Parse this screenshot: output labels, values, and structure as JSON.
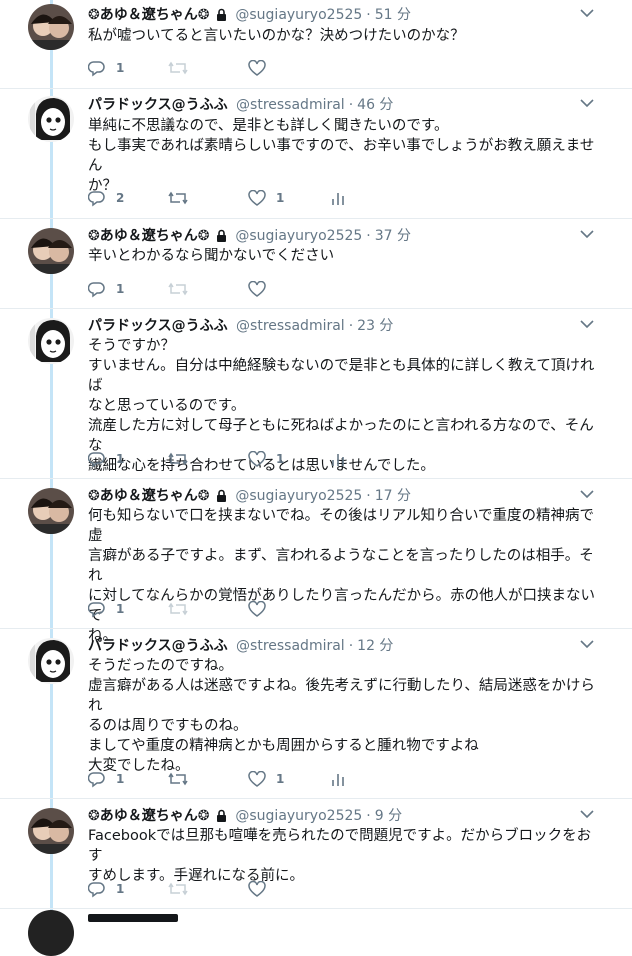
{
  "colors": {
    "thread_line": "#c4e4f7",
    "meta_gray": "#657786",
    "icon_gray": "#657786"
  },
  "icons": {
    "reply": "reply-icon",
    "retweet": "retweet-icon",
    "like": "heart-icon",
    "analytics": "analytics-icon",
    "menu": "chevron-down-icon",
    "lock": "lock-icon"
  },
  "tweets": [
    {
      "author": "❂あゆ＆遼ちゃん❂",
      "protected": true,
      "handle": "@sugiayuryo2525",
      "separator": "·",
      "time": "51 分",
      "lines": [
        "私が嘘ついてると言いたいのかな？決めつけたいのかな？"
      ],
      "reply_count": "1",
      "retweet_count": "",
      "like_count": "",
      "show_stats": false
    },
    {
      "author": "パラドックス@うふふ",
      "protected": false,
      "handle": "@stressadmiral",
      "separator": "·",
      "time": "46 分",
      "lines": [
        "単純に不思議なので、是非とも詳しく聞きたいのです。",
        "もし事実であれば素晴らしい事ですので、お辛い事でしょうがお教え願えません",
        "か？"
      ],
      "reply_count": "2",
      "retweet_count": "",
      "like_count": "1",
      "show_stats": true
    },
    {
      "author": "❂あゆ＆遼ちゃん❂",
      "protected": true,
      "handle": "@sugiayuryo2525",
      "separator": "·",
      "time": "37 分",
      "lines": [
        "辛いとわかるなら聞かないでください"
      ],
      "reply_count": "1",
      "retweet_count": "",
      "like_count": "",
      "show_stats": false
    },
    {
      "author": "パラドックス@うふふ",
      "protected": false,
      "handle": "@stressadmiral",
      "separator": "·",
      "time": "23 分",
      "lines": [
        "そうですか？",
        "すいません。自分は中絶経験もないので是非とも具体的に詳しく教えて頂ければ",
        "なと思っているのです。",
        "流産した方に対して母子ともに死ねばよかったのにと言われる方なので、そんな",
        "繊細な心を持ち合わせているとは思いませんでした。"
      ],
      "reply_count": "1",
      "retweet_count": "",
      "like_count": "1",
      "show_stats": true
    },
    {
      "author": "❂あゆ＆遼ちゃん❂",
      "protected": true,
      "handle": "@sugiayuryo2525",
      "separator": "·",
      "time": "17 分",
      "lines": [
        "何も知らないで口を挟まないでね。その後はリアル知り合いで重度の精神病で虚",
        "言癖がある子ですよ。まず、言われるようなことを言ったりしたのは相手。それ",
        "に対してなんらかの覚悟がありしたり言ったんだから。赤の他人が口挟まないで",
        "ね。"
      ],
      "reply_count": "1",
      "retweet_count": "",
      "like_count": "",
      "show_stats": false
    },
    {
      "author": "パラドックス@うふふ",
      "protected": false,
      "handle": "@stressadmiral",
      "separator": "·",
      "time": "12 分",
      "lines": [
        "そうだったのですね。",
        "虚言癖がある人は迷惑ですよね。後先考えずに行動したり、結局迷惑をかけられ",
        "るのは周りですものね。",
        "ましてや重度の精神病とかも周囲からすると腫れ物ですよね",
        "大変でしたね。"
      ],
      "reply_count": "1",
      "retweet_count": "",
      "like_count": "1",
      "show_stats": true
    },
    {
      "author": "❂あゆ＆遼ちゃん❂",
      "protected": true,
      "handle": "@sugiayuryo2525",
      "separator": "·",
      "time": "9 分",
      "lines": [
        "Facebookでは旦那も喧嘩を売られたので問題児ですよ。だからブロックをおす",
        "すめします。手遅れになる前に。"
      ],
      "reply_count": "1",
      "retweet_count": "",
      "like_count": "",
      "show_stats": false
    }
  ]
}
